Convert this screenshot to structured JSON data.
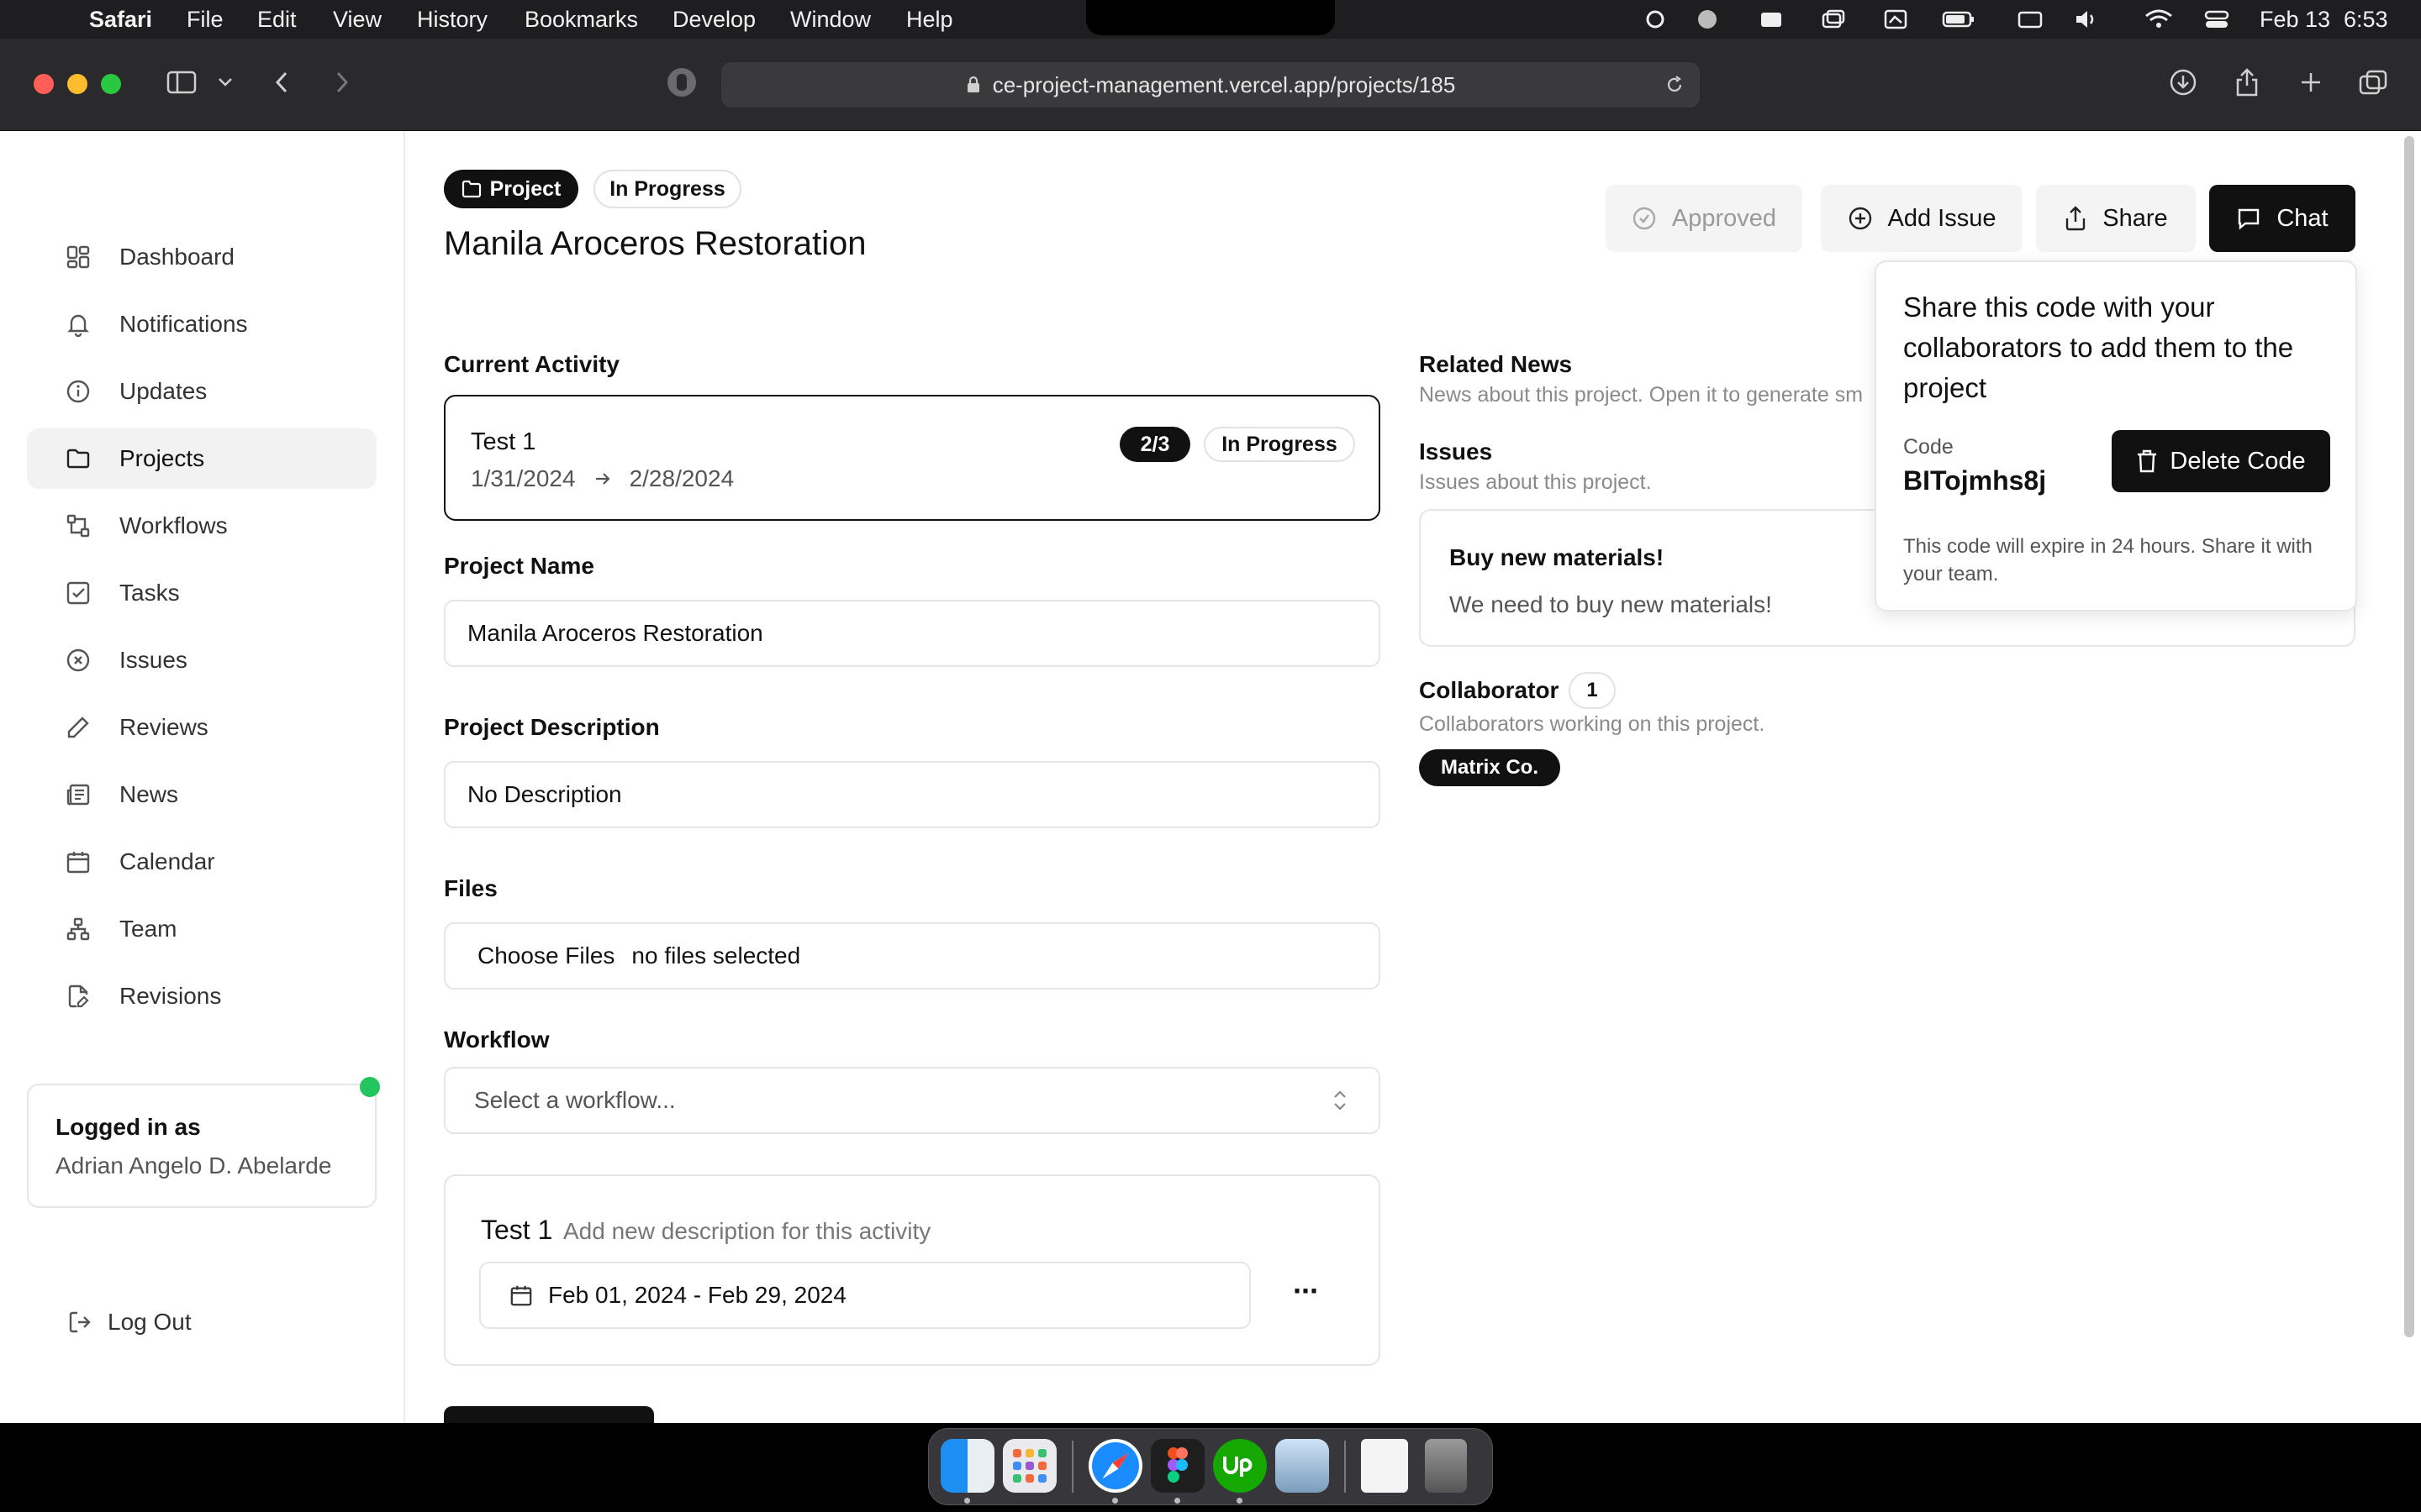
{
  "menubar": {
    "app": "Safari",
    "items": [
      "File",
      "Edit",
      "View",
      "History",
      "Bookmarks",
      "Develop",
      "Window",
      "Help"
    ],
    "date": "Feb 13",
    "time": "6:53"
  },
  "browser": {
    "url": "ce-project-management.vercel.app/projects/185"
  },
  "sidebar": {
    "items": [
      {
        "label": "Dashboard",
        "icon": "dashboard-icon"
      },
      {
        "label": "Notifications",
        "icon": "bell-icon"
      },
      {
        "label": "Updates",
        "icon": "info-icon"
      },
      {
        "label": "Projects",
        "icon": "folder-icon"
      },
      {
        "label": "Workflows",
        "icon": "workflow-icon"
      },
      {
        "label": "Tasks",
        "icon": "checkbox-icon"
      },
      {
        "label": "Issues",
        "icon": "circle-x-icon"
      },
      {
        "label": "Reviews",
        "icon": "pencil-icon"
      },
      {
        "label": "News",
        "icon": "newspaper-icon"
      },
      {
        "label": "Calendar",
        "icon": "calendar-icon"
      },
      {
        "label": "Team",
        "icon": "team-icon"
      },
      {
        "label": "Revisions",
        "icon": "file-edit-icon"
      }
    ],
    "active": "Projects",
    "logged_in_label": "Logged in as",
    "user_name": "Adrian Angelo D. Abelarde",
    "logout": "Log Out"
  },
  "header": {
    "type_badge": "Project",
    "status_badge": "In Progress",
    "title": "Manila Aroceros Restoration",
    "approved": "Approved",
    "add_issue": "Add Issue",
    "share": "Share",
    "chat": "Chat"
  },
  "current_activity": {
    "heading": "Current Activity",
    "name": "Test 1",
    "start": "1/31/2024",
    "end": "2/28/2024",
    "progress": "2/3",
    "status": "In Progress"
  },
  "form": {
    "name_label": "Project Name",
    "name_value": "Manila Aroceros Restoration",
    "desc_label": "Project Description",
    "desc_value": "No Description",
    "files_label": "Files",
    "choose_files": "Choose Files",
    "no_files": "no files selected",
    "workflow_label": "Workflow",
    "workflow_placeholder": "Select a workflow..."
  },
  "activity_card": {
    "name": "Test 1",
    "description_placeholder": "Add new description for this activity",
    "date_range": "Feb 01, 2024 - Feb 29, 2024",
    "more": "···"
  },
  "right": {
    "news_heading": "Related News",
    "news_sub": "News about this project. Open it to generate sm",
    "issues_heading": "Issues",
    "issues_sub": "Issues about this project.",
    "issue_title": "Buy new materials!",
    "issue_body": "We need to buy new materials!",
    "collab_heading": "Collaborator",
    "collab_count": "1",
    "collab_sub": "Collaborators working on this project.",
    "collab_name": "Matrix Co."
  },
  "popover": {
    "message": "Share this code with your collaborators to add them to the project",
    "code_label": "Code",
    "code": "BITojmhs8j",
    "delete": "Delete Code",
    "note": "This code will expire in 24 hours. Share it with your team."
  }
}
